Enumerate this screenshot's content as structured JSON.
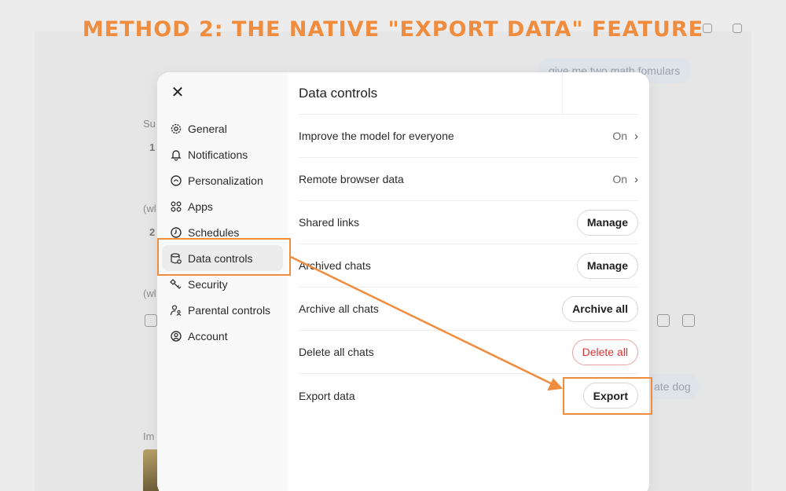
{
  "headline": "METHOD 2: THE NATIVE \"EXPORT DATA\" FEATURE",
  "background": {
    "bubble_top": "give me two math fomulars",
    "bubble_bottom": "ate dog",
    "fragments": [
      "Su",
      "1",
      "(wl",
      "2",
      "(wl",
      "Im"
    ]
  },
  "modal": {
    "close_label": "✕",
    "sidebar": {
      "items": [
        {
          "label": "General",
          "icon": "gear-icon"
        },
        {
          "label": "Notifications",
          "icon": "bell-icon"
        },
        {
          "label": "Personalization",
          "icon": "personalization-icon"
        },
        {
          "label": "Apps",
          "icon": "apps-grid-icon"
        },
        {
          "label": "Schedules",
          "icon": "clock-icon"
        },
        {
          "label": "Data controls",
          "icon": "database-icon",
          "active": true
        },
        {
          "label": "Security",
          "icon": "key-icon"
        },
        {
          "label": "Parental controls",
          "icon": "parental-icon"
        },
        {
          "label": "Account",
          "icon": "account-icon"
        }
      ]
    },
    "title": "Data controls",
    "rows": [
      {
        "label": "Improve the model for everyone",
        "value": "On",
        "chevron": "›"
      },
      {
        "label": "Remote browser data",
        "value": "On",
        "chevron": "›"
      },
      {
        "label": "Shared links",
        "button": "Manage"
      },
      {
        "label": "Archived chats",
        "button": "Manage"
      },
      {
        "label": "Archive all chats",
        "button": "Archive all"
      },
      {
        "label": "Delete all chats",
        "button": "Delete all"
      },
      {
        "label": "Export data",
        "button": "Export"
      }
    ]
  },
  "colors": {
    "annotation": "#ef8c3e",
    "danger": "#d03434"
  }
}
